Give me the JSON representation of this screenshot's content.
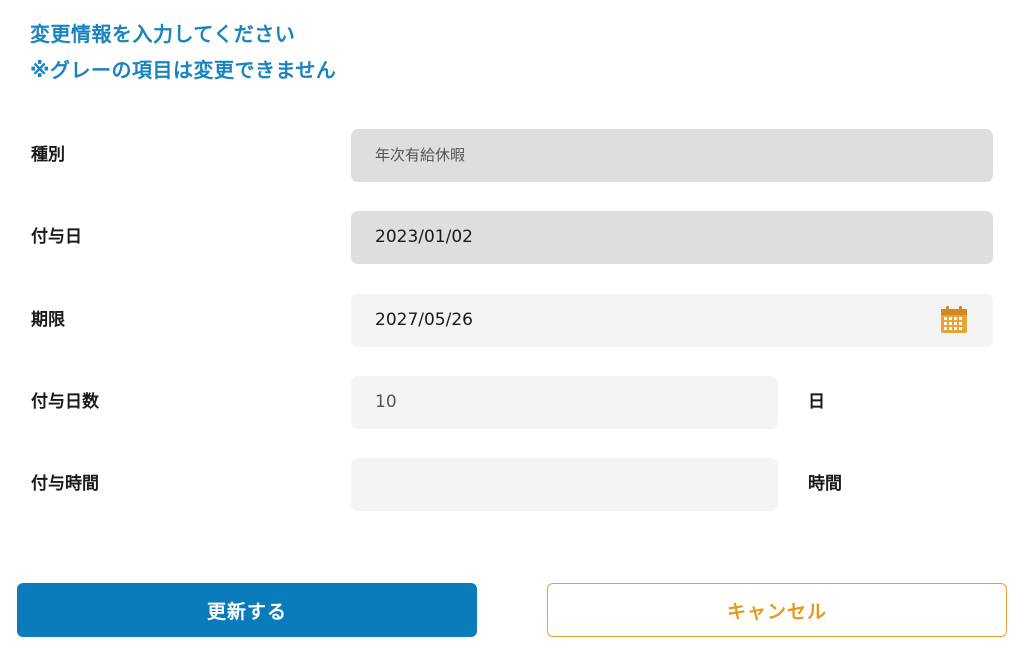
{
  "intro": {
    "line1": "変更情報を入力してください",
    "line2": "※グレーの項目は変更できません"
  },
  "form": {
    "kind": {
      "label": "種別",
      "value": "年次有給休暇"
    },
    "grant_date": {
      "label": "付与日",
      "value": "2023/01/02"
    },
    "expiry": {
      "label": "期限",
      "value": "2027/05/26",
      "icon": "calendar-icon"
    },
    "grant_days": {
      "label": "付与日数",
      "value": "10",
      "unit": "日"
    },
    "grant_hours": {
      "label": "付与時間",
      "value": "",
      "unit": "時間"
    }
  },
  "buttons": {
    "update_label": "更新する",
    "cancel_label": "キャンセル"
  },
  "colors": {
    "accent_blue": "#0a7bbb",
    "intro_text": "#1a84bf",
    "cancel_orange": "#e69a1d",
    "locked_field": "#dedede",
    "editable_field": "#f4f4f4"
  }
}
